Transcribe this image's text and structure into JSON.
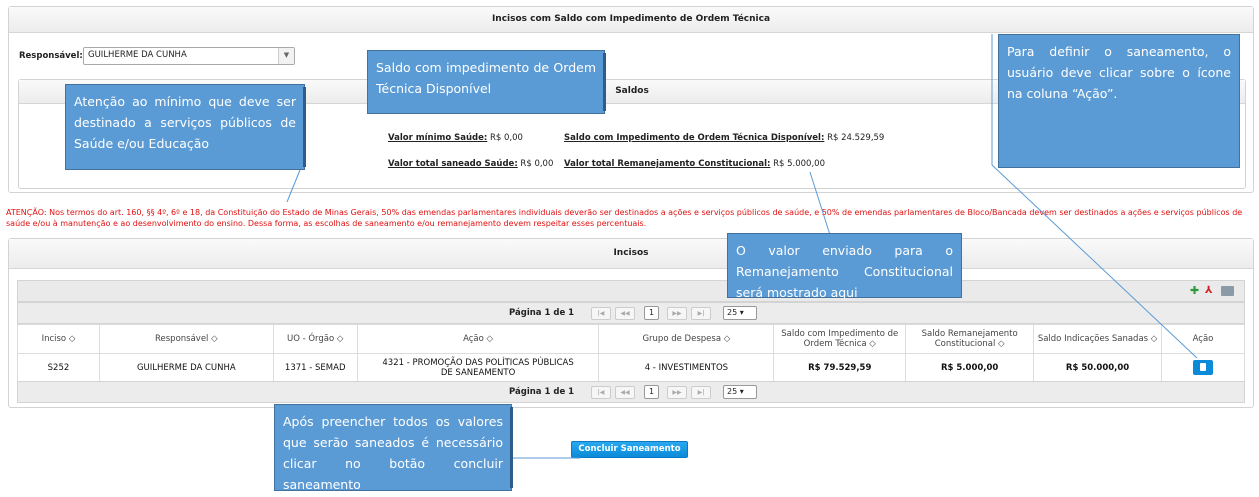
{
  "top_panel": {
    "title": "Incisos com Saldo com Impedimento de Ordem Técnica"
  },
  "responsavel": {
    "label": "Responsável:",
    "value": "GUILHERME DA CUNHA"
  },
  "saldos": {
    "title": "Saldos",
    "valor_minimo_label": "Valor mínimo Saúde:",
    "valor_minimo_value": "R$ 0,00",
    "valor_saneado_label": "Valor total saneado Saúde:",
    "valor_saneado_value": "R$ 0,00",
    "saldo_imp_label": "Saldo com Impedimento de Ordem Técnica Disponível:",
    "saldo_imp_value": "R$ 24.529,59",
    "remanej_label": "Valor total Remanejamento Constitucional:",
    "remanej_value": "R$ 5.000,00"
  },
  "warning": "ATENÇÃO: Nos termos do art. 160, §§ 4º, 6º e 18, da Constituição do Estado de Minas Gerais, 50% das emendas parlamentares individuais deverão ser destinados a ações e serviços públicos de saúde, e 50% de emendas parlamentares de Bloco/Bancada devem ser destinados a ações e serviços públicos de saúde e/ou à manutenção e ao desenvolvimento do ensino. Dessa forma, as escolhas de saneamento e/ou remanejamento devem respeitar esses percentuais.",
  "incisos": {
    "title": "Incisos",
    "pager": {
      "text": "Página 1 de 1",
      "page": "1",
      "per_page": "25",
      "first": "|◀",
      "prev": "◀◀",
      "next": "▶▶",
      "last": "▶|"
    },
    "columns": [
      "Inciso ◇",
      "Responsável ◇",
      "UO - Órgão ◇",
      "Ação ◇",
      "Grupo de Despesa ◇",
      "Saldo com Impedimento de Ordem Técnica ◇",
      "Saldo Remanejamento Constitucional ◇",
      "Saldo Indicações Sanadas ◇",
      "Ação"
    ],
    "rows": [
      {
        "inciso": "S252",
        "responsavel": "GUILHERME DA CUNHA",
        "uo": "1371 - SEMAD",
        "acao": "4321 - PROMOÇÃO DAS POLÍTICAS PÚBLICAS DE SANEAMENTO",
        "grupo": "4 - INVESTIMENTOS",
        "saldo_imp": "R$ 79.529,59",
        "saldo_rem": "R$ 5.000,00",
        "saldo_ind": "R$ 50.000,00"
      }
    ]
  },
  "concluir_button": "Concluir Saneamento",
  "callouts": {
    "saldo_imp": "Saldo com impedimento de Ordem Técnica Disponível",
    "atencao": "Atenção ao mínimo que deve ser destinado a serviços públicos de Saúde e/ou Educação",
    "definir": "Para definir o saneamento, o usuário deve clicar sobre o ícone na coluna “Ação”.",
    "valor_enviado": "O valor enviado para o Remanejamento Constitucional será mostrado aqui",
    "apos": "Após preencher todos os valores que serão saneados é necessário clicar no botão concluir saneamento"
  },
  "colors": {
    "callout": "#5b9bd5",
    "warning": "#e01010",
    "button": "#0a8ad8"
  }
}
